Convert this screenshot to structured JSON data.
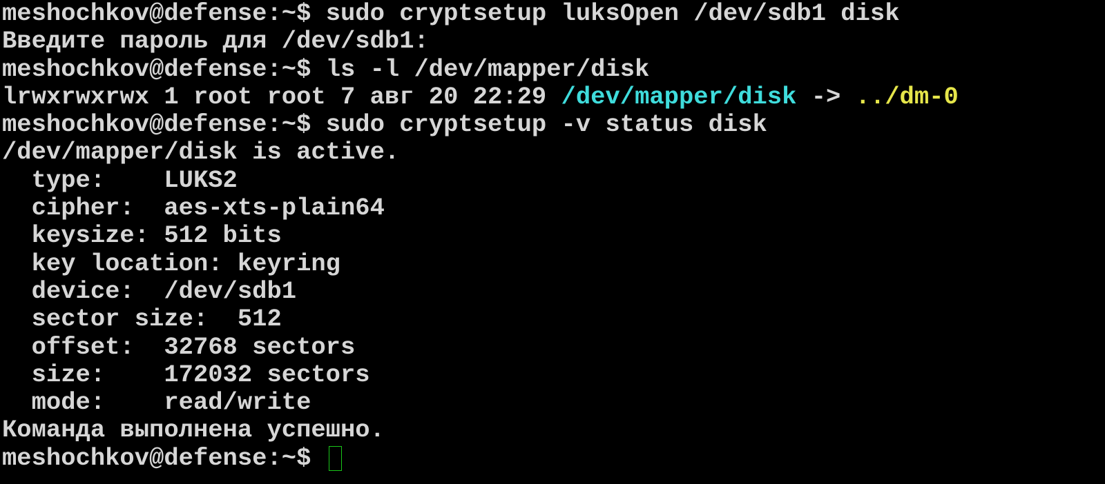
{
  "colors": {
    "background": "#000000",
    "text": "#d6d6d6",
    "link_path": "#3fdcdc",
    "link_target": "#e6e64a",
    "cursor_border": "#19c719"
  },
  "prompt": "meshochkov@defense:~$ ",
  "lines": {
    "cmd_luksopen": "sudo cryptsetup luksOpen /dev/sdb1 disk",
    "password_prompt": "Введите пароль для /dev/sdb1:",
    "cmd_ls": "ls -l /dev/mapper/disk",
    "ls_prefix": "lrwxrwxrwx 1 root root 7 авг 20 22:29 ",
    "ls_path": "/dev/mapper/disk",
    "ls_arrow": " -> ",
    "ls_target": "../dm-0",
    "cmd_status": "sudo cryptsetup -v status disk",
    "status_active": "/dev/mapper/disk is active.",
    "type": "  type:    LUKS2",
    "cipher": "  cipher:  aes-xts-plain64",
    "keysize": "  keysize: 512 bits",
    "key_location": "  key location: keyring",
    "device": "  device:  /dev/sdb1",
    "sector_size": "  sector size:  512",
    "offset": "  offset:  32768 sectors",
    "size": "  size:    172032 sectors",
    "mode": "  mode:    read/write",
    "success": "Команда выполнена успешно."
  }
}
